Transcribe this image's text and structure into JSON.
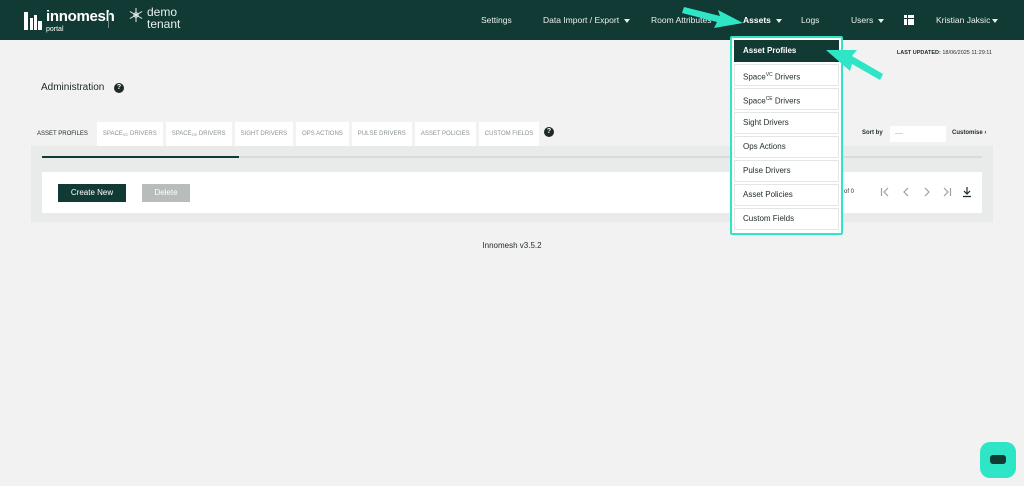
{
  "brand": {
    "name": "innomesh",
    "sub": "portal",
    "tenant_line1": "demo",
    "tenant_line2": "tenant"
  },
  "nav": {
    "settings": "Settings",
    "data_import": "Data Import / Export",
    "room_attributes": "Room Attributes",
    "assets": "Assets",
    "logs": "Logs",
    "users": "Users",
    "user_name": "Kristian Jaksic"
  },
  "header": {
    "last_updated_label": "LAST UPDATED:",
    "last_updated_value": "18/06/2025 11:29:11",
    "title": "Administration",
    "help": "?"
  },
  "tabs": [
    {
      "label": "ASSET PROFILES",
      "sup": "",
      "suffix": ""
    },
    {
      "label": "SPACE",
      "sup": "VC",
      "suffix": " DRIVERS"
    },
    {
      "label": "SPACE",
      "sup": "CE",
      "suffix": " DRIVERS"
    },
    {
      "label": "SIGHT DRIVERS",
      "sup": "",
      "suffix": ""
    },
    {
      "label": "OPS ACTIONS",
      "sup": "",
      "suffix": ""
    },
    {
      "label": "PULSE DRIVERS",
      "sup": "",
      "suffix": ""
    },
    {
      "label": "ASSET POLICIES",
      "sup": "",
      "suffix": ""
    },
    {
      "label": "CUSTOM FIELDS",
      "sup": "",
      "suffix": ""
    }
  ],
  "sort": {
    "label": "Sort by",
    "value": "----",
    "customise": "Customise"
  },
  "toolbar": {
    "create_new": "Create New",
    "delete": "Delete",
    "pager_text": "of 0"
  },
  "footer": {
    "version": "Innomesh v3.5.2"
  },
  "dropdown": {
    "items": [
      {
        "label": "Asset Profiles",
        "sup": "",
        "suffix": ""
      },
      {
        "label": "Space",
        "sup": "VC",
        "suffix": " Drivers"
      },
      {
        "label": "Space",
        "sup": "CE",
        "suffix": " Drivers"
      },
      {
        "label": "Sight Drivers",
        "sup": "",
        "suffix": ""
      },
      {
        "label": "Ops Actions",
        "sup": "",
        "suffix": ""
      },
      {
        "label": "Pulse Drivers",
        "sup": "",
        "suffix": ""
      },
      {
        "label": "Asset Policies",
        "sup": "",
        "suffix": ""
      },
      {
        "label": "Custom Fields",
        "sup": "",
        "suffix": ""
      }
    ],
    "selected_index": 0
  },
  "tab_progress": 0.21,
  "colors": {
    "primary": "#123a35",
    "accent": "#2ee6c6",
    "background": "#f2f2f2"
  }
}
